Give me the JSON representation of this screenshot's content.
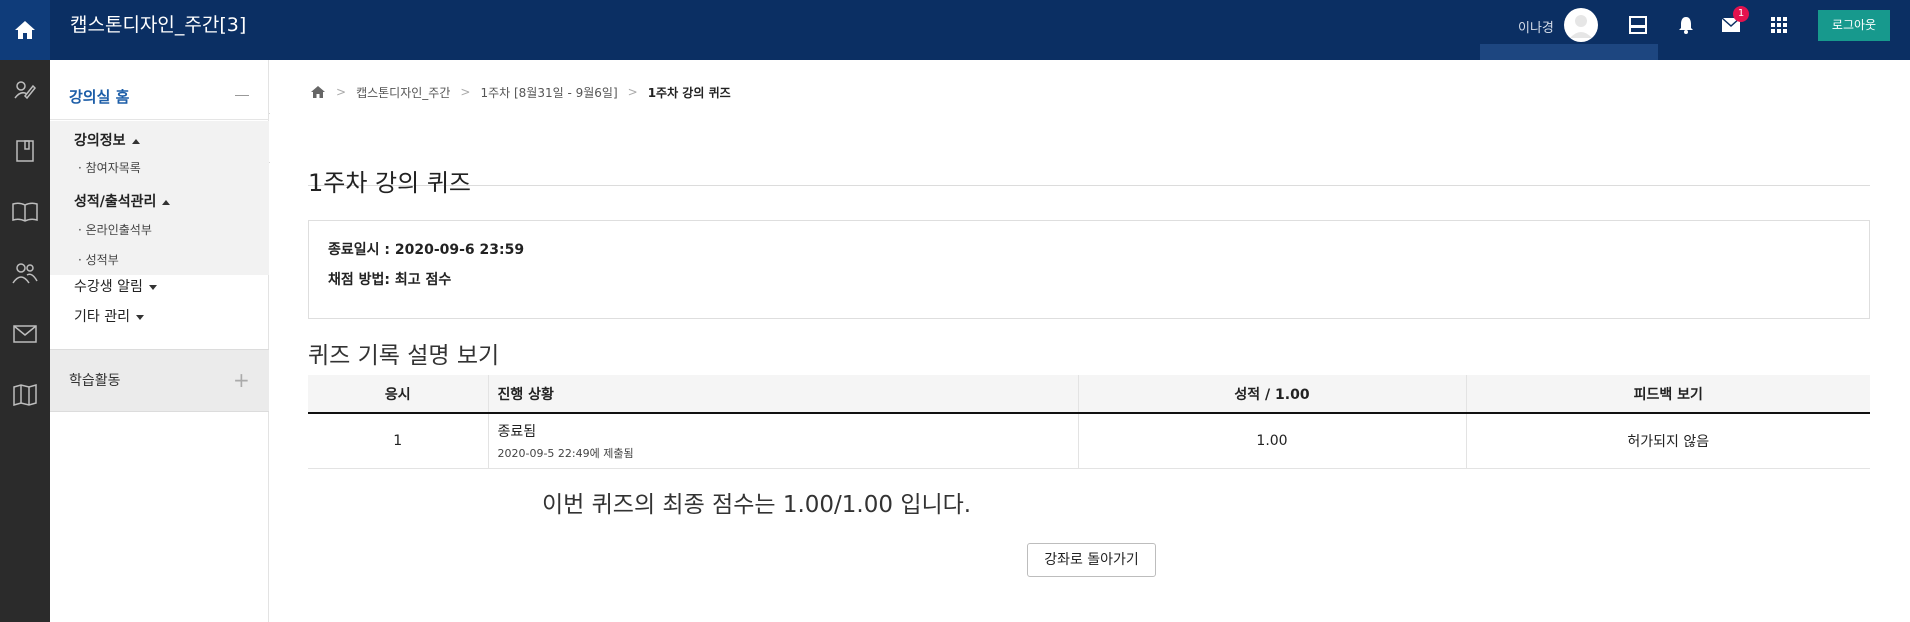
{
  "header": {
    "site_title": "캡스톤디자인_주간[3]",
    "user_name": "이나경",
    "message_count": "1",
    "logout_label": "로그아웃",
    "icons": [
      "home-icon",
      "layout-icon",
      "bell-icon",
      "mail-icon",
      "apps-grid-icon"
    ],
    "accent_color": "#17998d",
    "bar_color": "#0b2f63"
  },
  "rail": {
    "icons": [
      "edit-icon",
      "notebook-icon",
      "open-book-icon",
      "people-icon",
      "envelope-icon",
      "map-icon"
    ]
  },
  "sidebar": {
    "home_label": "강의실 홈",
    "course_info": {
      "label": "강의정보",
      "items": [
        "참여자목록"
      ]
    },
    "grades": {
      "label": "성적/출석관리",
      "items": [
        "온라인출석부",
        "성적부"
      ]
    },
    "student_alerts": "수강생 알림",
    "other_management": "기타 관리",
    "activities": "학습활동"
  },
  "breadcrumb": {
    "items": [
      "캡스톤디자인_주간",
      "1주차 [8월31일 - 9월6일]",
      "1주차 강의 퀴즈"
    ]
  },
  "quiz": {
    "title": "1주차 강의 퀴즈",
    "close_time": "종료일시 : 2020-09-6 23:59",
    "grading_method": "채점 방법: 최고 점수",
    "section_title": "퀴즈 기록 설명 보기",
    "table": {
      "headers": [
        "응시",
        "진행 상황",
        "성적 / 1.00",
        "피드백 보기"
      ],
      "rows": [
        {
          "attempt": "1",
          "state": "종료됨",
          "submitted": "2020-09-5 22:49에 제출됨",
          "grade": "1.00",
          "feedback": "허가되지 않음"
        }
      ]
    },
    "final_score": "이번 퀴즈의 최종 점수는 1.00/1.00 입니다.",
    "back_button": "강좌로 돌아가기"
  }
}
